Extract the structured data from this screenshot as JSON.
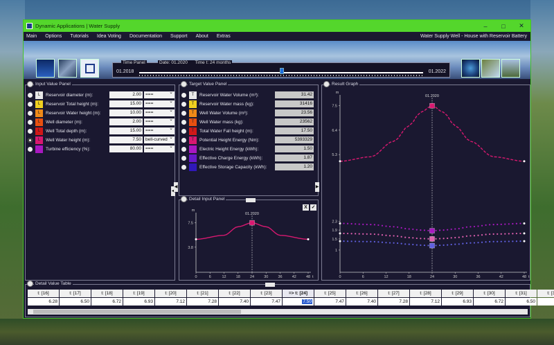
{
  "window": {
    "title": "Dynamic Applications | Water Supply",
    "subtitle_right": "Water Supply Well - House with Reservoir Battery",
    "controls": [
      "minimize",
      "maximize",
      "close"
    ]
  },
  "menu": [
    "Main",
    "Options",
    "Tutorials",
    "Idea Voting",
    "Documentation",
    "Support",
    "About",
    "Extras"
  ],
  "time_panel": {
    "title": "Time Panel",
    "date_label": "Date:",
    "date_value": "01.2020",
    "time_label": "Time t:",
    "time_value": "24",
    "time_unit": "months",
    "start": "01.2018",
    "end": "01.2022",
    "slider_position": 0.5
  },
  "input_panel": {
    "title": "Input Value Panel",
    "rows": [
      {
        "label": "Reservoir diameter (m):",
        "value": "2.00",
        "mode": "===",
        "color": "#e8e8e8",
        "symbol": "L"
      },
      {
        "label": "Reservoir Total height (m):",
        "value": "15.00",
        "mode": "===",
        "color": "#f0d020",
        "symbol": "L"
      },
      {
        "label": "Reservoir Water height (m):",
        "value": "10.00",
        "mode": "===",
        "color": "#f08a18",
        "symbol": "L"
      },
      {
        "label": "Well diameter (m):",
        "value": "2.00",
        "mode": "===",
        "color": "#e85010",
        "symbol": "L"
      },
      {
        "label": "Well Total depth (m):",
        "value": "15.00",
        "mode": "===",
        "color": "#d01818",
        "symbol": "L"
      },
      {
        "label": "Well Water height (m):",
        "value": "7.50",
        "mode": "bell-curved",
        "color": "#d81870",
        "symbol": "L"
      },
      {
        "label": "Turbine efficiency (%):",
        "value": "80.00",
        "mode": "===",
        "color": "#a818c0",
        "symbol": ""
      }
    ],
    "selected_index": 5
  },
  "target_panel": {
    "title": "Target Value Panel",
    "rows": [
      {
        "label": "Reservoir Water Volume (m³):",
        "value": "31.42",
        "color": "#e8e8e8",
        "symbol": "T"
      },
      {
        "label": "Reservoir Water mass (kg):",
        "value": "31416",
        "color": "#f0d020",
        "symbol": "T"
      },
      {
        "label": "Well Water Volume (m³):",
        "value": "23.56",
        "color": "#f08a18",
        "symbol": "T"
      },
      {
        "label": "Well Water mass (kg):",
        "value": "23562",
        "color": "#e85010",
        "symbol": "T"
      },
      {
        "label": "Total Water Fall height (m):",
        "value": "17.50",
        "color": "#d01818",
        "symbol": "T"
      },
      {
        "label": "Potential Height Energy (Nm):",
        "value": "5393329",
        "color": "#d81870",
        "symbol": "T"
      },
      {
        "label": "Electric Height Energy (kWh):",
        "value": "1.50",
        "color": "#a818c0",
        "symbol": ""
      },
      {
        "label": "Effective Charge Energy (kWh):",
        "value": "1.87",
        "color": "#6818c8",
        "symbol": ""
      },
      {
        "label": "Effective Storage Capacity (kWh):",
        "value": "1.20",
        "color": "#3018b8",
        "symbol": ""
      }
    ]
  },
  "detail_input_panel": {
    "title": "Detail Input Panel",
    "close_label": "X",
    "accept_label": "✓"
  },
  "result_graph": {
    "title": "Result Graph"
  },
  "detail_table": {
    "title": "Detail Value Table",
    "headers": [
      "t: [16]",
      "t: [17]",
      "t: [18]",
      "t: [19]",
      "t: [20]",
      "t: [21]",
      "t: [22]",
      "t: [23]",
      "=> t: [24]",
      "t: [25]",
      "t: [26]",
      "t: [27]",
      "t: [28]",
      "t: [29]",
      "t: [30]",
      "t: [31]",
      "t: [32]"
    ],
    "values": [
      "6.28",
      "6.50",
      "6.72",
      "6.93",
      "7.12",
      "7.28",
      "7.40",
      "7.47",
      "7.50",
      "7.47",
      "7.40",
      "7.28",
      "7.12",
      "6.93",
      "6.72",
      "6.50",
      "6.2"
    ],
    "current_index": 8
  },
  "chart_data": [
    {
      "type": "line",
      "name": "detail-input",
      "ylabel": "m",
      "xlabel": "t",
      "xlim": [
        0,
        48
      ],
      "ylim": [
        0,
        8.4
      ],
      "x_ticks": [
        0,
        6,
        12,
        18,
        24,
        30,
        36,
        42,
        48
      ],
      "y_ticks": [
        3.8,
        7.5
      ],
      "marker_label": "01.2020",
      "marker_x": 24,
      "series": [
        {
          "color": "#d81870",
          "x": [
            0,
            12,
            18,
            24,
            30,
            36,
            48
          ],
          "y": [
            5.0,
            5.6,
            6.9,
            7.5,
            6.9,
            5.6,
            5.0
          ]
        }
      ]
    },
    {
      "type": "line",
      "name": "result",
      "ylabel": "m",
      "xlabel": "t",
      "xlim": [
        0,
        48
      ],
      "ylim": [
        0,
        7.8
      ],
      "x_ticks": [
        0,
        6,
        12,
        18,
        24,
        30,
        36,
        42,
        48
      ],
      "y_ticks": [
        1.0,
        1.5,
        1.9,
        2.3,
        5.3,
        6.4,
        7.5
      ],
      "marker_label": "01.2020",
      "marker_x": 24,
      "series": [
        {
          "color": "#d81870",
          "x": [
            0,
            8,
            14,
            18,
            21,
            24,
            27,
            30,
            34,
            40,
            48
          ],
          "y": [
            5.0,
            5.2,
            5.9,
            6.6,
            7.2,
            7.5,
            7.2,
            6.6,
            5.9,
            5.2,
            5.0
          ]
        },
        {
          "color": "#a818c0",
          "x": [
            0,
            8,
            14,
            18,
            21,
            24,
            27,
            30,
            34,
            40,
            48
          ],
          "y": [
            2.2,
            2.15,
            2.05,
            1.95,
            1.9,
            1.87,
            1.9,
            1.95,
            2.05,
            2.15,
            2.2
          ]
        },
        {
          "color": "#e060b0",
          "x": [
            0,
            8,
            14,
            18,
            21,
            24,
            27,
            30,
            34,
            40,
            48
          ],
          "y": [
            1.75,
            1.72,
            1.64,
            1.56,
            1.52,
            1.5,
            1.52,
            1.56,
            1.64,
            1.72,
            1.75
          ]
        },
        {
          "color": "#6060e0",
          "x": [
            0,
            8,
            14,
            18,
            21,
            24,
            27,
            30,
            34,
            40,
            48
          ],
          "y": [
            1.4,
            1.38,
            1.32,
            1.26,
            1.22,
            1.2,
            1.22,
            1.26,
            1.32,
            1.38,
            1.4
          ]
        }
      ]
    }
  ]
}
